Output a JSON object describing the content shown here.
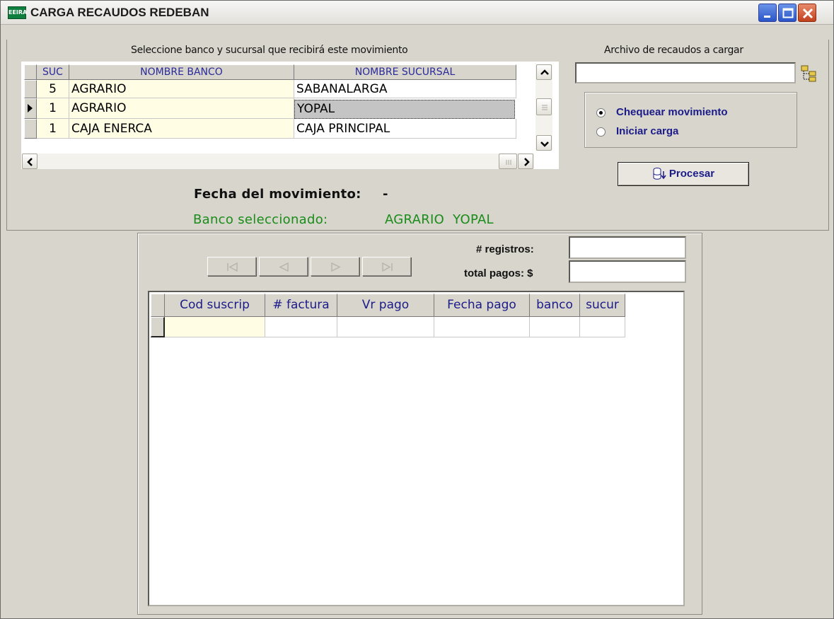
{
  "window": {
    "app_icon_text": "EEIRA",
    "title": "CARGA RECAUDOS REDEBAN",
    "minimize_label": "Minimize",
    "maximize_label": "Maximize",
    "close_label": "Close"
  },
  "bank_selector": {
    "caption": "Seleccione banco y sucursal que recibirá este movimiento",
    "columns": [
      "SUC",
      "NOMBRE BANCO",
      "NOMBRE SUCURSAL"
    ],
    "rows": [
      {
        "suc": "5",
        "banco": "AGRARIO",
        "sucursal": "SABANALARGA"
      },
      {
        "suc": "1",
        "banco": "AGRARIO",
        "sucursal": "YOPAL"
      },
      {
        "suc": "1",
        "banco": "CAJA ENERCA",
        "sucursal": "CAJA PRINCIPAL"
      }
    ],
    "selected_row": 1
  },
  "file": {
    "caption": "Archivo de recaudos a cargar",
    "value": "",
    "browse_icon": "folder-tree-icon"
  },
  "options": {
    "items": [
      {
        "label": "Chequear movimiento",
        "selected": true
      },
      {
        "label": "Iniciar carga",
        "selected": false
      }
    ]
  },
  "procesar_button": {
    "label": "Procesar",
    "icon": "process-db-icon"
  },
  "info": {
    "fecha_label": "Fecha del movimiento:",
    "fecha_value": "-",
    "banco_label": "Banco seleccionado:",
    "banco_value": "AGRARIO  YOPAL"
  },
  "navigator": {
    "buttons": [
      "first-record-icon",
      "prev-record-icon",
      "next-record-icon",
      "last-record-icon"
    ],
    "enabled": false
  },
  "totals": {
    "registros_label": "# registros:",
    "registros_value": "",
    "pagos_label": "total pagos: $",
    "pagos_value": ""
  },
  "payments_grid": {
    "columns": [
      "Cod suscrip",
      "# factura",
      "Vr pago",
      "Fecha pago",
      "banco",
      "sucur"
    ],
    "rows": [
      [
        "",
        "",
        "",
        "",
        "",
        ""
      ]
    ]
  },
  "colors": {
    "face": "#d8d5cc",
    "header_text": "#1b1b8a",
    "green_text": "#1a8c1a",
    "yellow_cell": "#fffde3"
  }
}
